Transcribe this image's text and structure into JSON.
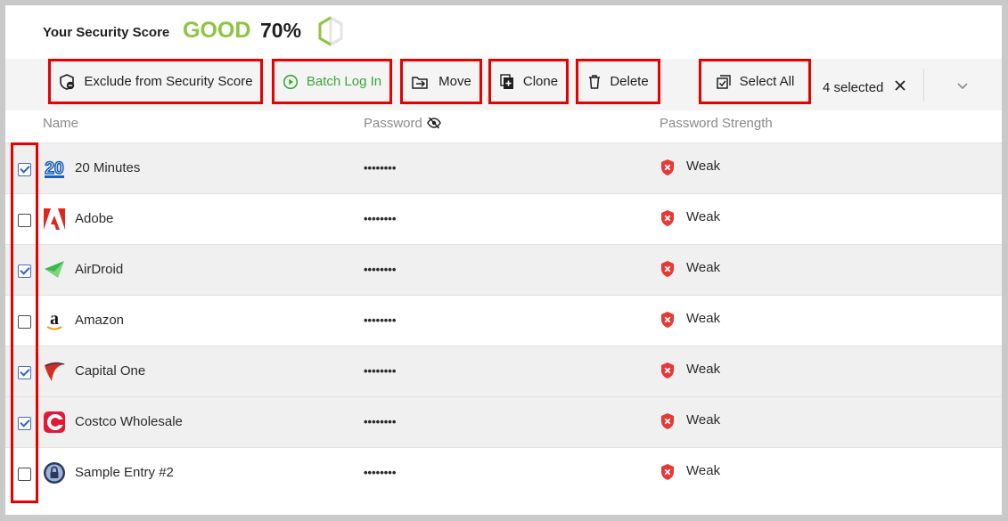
{
  "security_score": {
    "label": "Your Security Score",
    "rating": "GOOD",
    "percent": "70%"
  },
  "toolbar": {
    "exclude_label": "Exclude from Security Score",
    "batch_login_label": "Batch Log In",
    "move_label": "Move",
    "clone_label": "Clone",
    "delete_label": "Delete",
    "select_all_label": "Select All",
    "selected_count": "4 selected"
  },
  "columns": {
    "name": "Name",
    "password": "Password",
    "strength": "Password Strength"
  },
  "rows": [
    {
      "name": "20 Minutes",
      "password": "••••••••",
      "strength": "Weak",
      "checked": true,
      "logo": "20-minutes-logo"
    },
    {
      "name": "Adobe",
      "password": "••••••••",
      "strength": "Weak",
      "checked": false,
      "logo": "adobe-logo"
    },
    {
      "name": "AirDroid",
      "password": "••••••••",
      "strength": "Weak",
      "checked": true,
      "logo": "airdroid-logo"
    },
    {
      "name": "Amazon",
      "password": "••••••••",
      "strength": "Weak",
      "checked": false,
      "logo": "amazon-logo"
    },
    {
      "name": "Capital One",
      "password": "••••••••",
      "strength": "Weak",
      "checked": true,
      "logo": "capital-one-logo"
    },
    {
      "name": "Costco Wholesale",
      "password": "••••••••",
      "strength": "Weak",
      "checked": true,
      "logo": "costco-logo"
    },
    {
      "name": "Sample Entry #2",
      "password": "••••••••",
      "strength": "Weak",
      "checked": false,
      "logo": "generic-lock-logo"
    }
  ],
  "colors": {
    "accent_good": "#8cc63f",
    "batch_login_green": "#3aa63a",
    "weak_red": "#e53935",
    "highlight_red": "#e60000",
    "checkbox_blue": "#2f62c8"
  }
}
